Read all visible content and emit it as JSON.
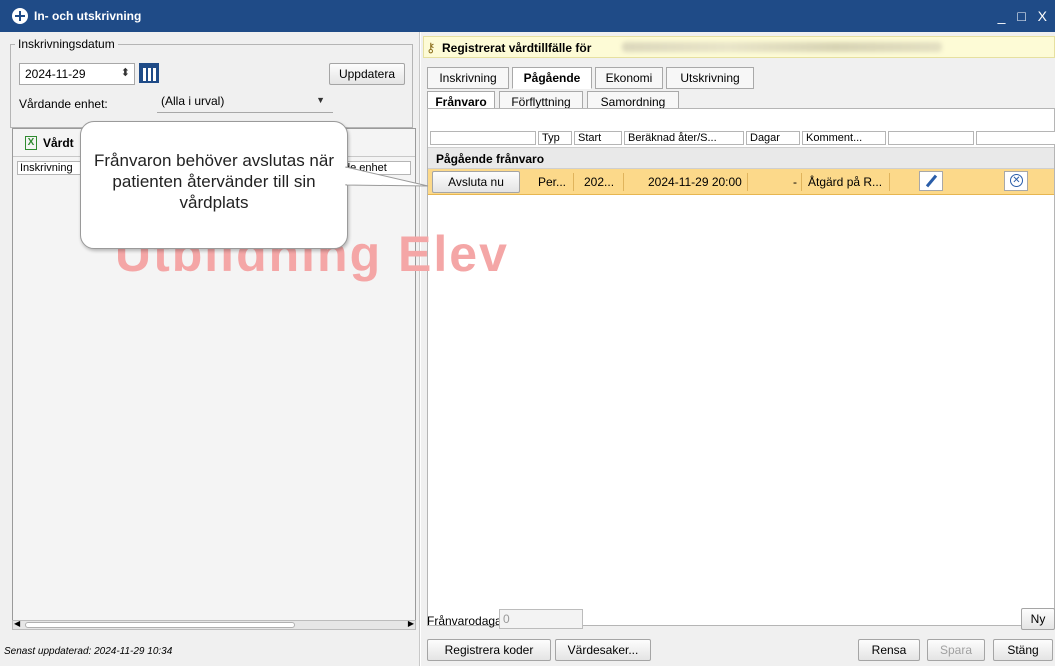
{
  "window": {
    "title": "In- och utskrivning",
    "controls": "_ □ X"
  },
  "left": {
    "fieldset_legend": "Inskrivningsdatum",
    "date_value": "2024-11-29",
    "update_button": "Uppdatera",
    "unit_label": "Vårdande enhet:",
    "unit_value": "(Alla i urval)",
    "panel_title": "Vårdt",
    "columns": [
      "Inskrivning",
      "de enhet"
    ],
    "last_updated": "Senast uppdaterad: 2024-11-29 10:34"
  },
  "watermark": "Utbildning Elev",
  "callout_text": "Frånvaron behöver avslutas när patienten återvänder till sin vårdplats",
  "right": {
    "patient_label": "Registrerat vårdtillfälle för",
    "tabs": [
      "Inskrivning",
      "Pågående",
      "Ekonomi",
      "Utskrivning"
    ],
    "subtabs": [
      "Frånvaro",
      "Förflyttning",
      "Samordning"
    ],
    "columns": [
      "Typ",
      "Start",
      "Beräknad åter/S...",
      "Dagar",
      "Komment..."
    ],
    "section_title": "Pågående frånvaro",
    "row": {
      "action_button": "Avsluta nu",
      "typ": "Per...",
      "start": "202...",
      "return": "2024-11-29 20:00",
      "days": "-",
      "comment": "Åtgärd på R..."
    },
    "absence_days_label": "Frånvarodagar:",
    "absence_days_value": "0",
    "new_button": "Ny",
    "buttons": {
      "register_codes": "Registrera koder",
      "valuables": "Värdesaker...",
      "clear": "Rensa",
      "save": "Spara",
      "close": "Stäng"
    }
  }
}
